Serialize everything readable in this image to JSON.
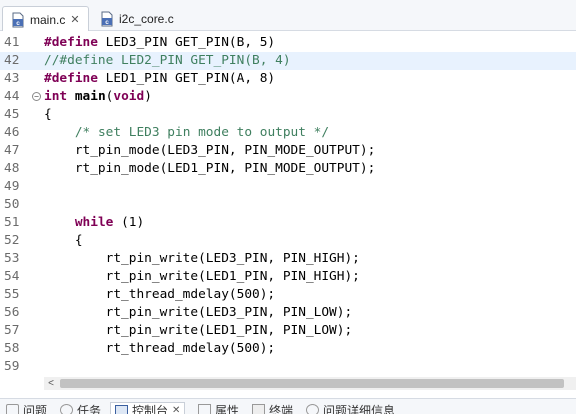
{
  "tabs": [
    {
      "label": "main.c",
      "active": true,
      "close_glyph": "✕",
      "icon": "c-file-icon"
    },
    {
      "label": "i2c_core.c",
      "active": false,
      "icon": "c-file-icon"
    }
  ],
  "editor": {
    "lines": [
      {
        "num": "41",
        "segments": [
          {
            "t": "#define",
            "s": "kw"
          },
          {
            "t": " LED3_PIN GET_PIN(B, 5)",
            "s": ""
          }
        ]
      },
      {
        "num": "42",
        "highlight": true,
        "segments": [
          {
            "t": "//#define LED2_PIN GET_PIN(B, 4)",
            "s": "cm"
          }
        ]
      },
      {
        "num": "43",
        "segments": [
          {
            "t": "#define",
            "s": "kw"
          },
          {
            "t": " LED1_PIN GET_PIN(A, 8)",
            "s": ""
          }
        ]
      },
      {
        "num": "44",
        "fold": true,
        "segments": [
          {
            "t": "int",
            "s": "kw"
          },
          {
            "t": " ",
            "s": ""
          },
          {
            "t": "main",
            "s": "b"
          },
          {
            "t": "(",
            "s": ""
          },
          {
            "t": "void",
            "s": "kw"
          },
          {
            "t": ")",
            "s": ""
          }
        ]
      },
      {
        "num": "45",
        "segments": [
          {
            "t": "{",
            "s": ""
          }
        ]
      },
      {
        "num": "46",
        "segments": [
          {
            "t": "    ",
            "s": ""
          },
          {
            "t": "/* set LED3 pin mode to output */",
            "s": "cm"
          }
        ]
      },
      {
        "num": "47",
        "segments": [
          {
            "t": "    rt_pin_mode(LED3_PIN, PIN_MODE_OUTPUT);",
            "s": ""
          }
        ]
      },
      {
        "num": "48",
        "segments": [
          {
            "t": "    rt_pin_mode(LED1_PIN, PIN_MODE_OUTPUT);",
            "s": ""
          }
        ]
      },
      {
        "num": "49",
        "segments": []
      },
      {
        "num": "50",
        "segments": []
      },
      {
        "num": "51",
        "segments": [
          {
            "t": "    ",
            "s": ""
          },
          {
            "t": "while",
            "s": "kw"
          },
          {
            "t": " (1)",
            "s": ""
          }
        ]
      },
      {
        "num": "52",
        "segments": [
          {
            "t": "    {",
            "s": ""
          }
        ]
      },
      {
        "num": "53",
        "segments": [
          {
            "t": "        rt_pin_write(LED3_PIN, PIN_HIGH);",
            "s": ""
          }
        ]
      },
      {
        "num": "54",
        "segments": [
          {
            "t": "        rt_pin_write(LED1_PIN, PIN_HIGH);",
            "s": ""
          }
        ]
      },
      {
        "num": "55",
        "segments": [
          {
            "t": "        rt_thread_mdelay(500);",
            "s": ""
          }
        ]
      },
      {
        "num": "56",
        "segments": [
          {
            "t": "        rt_pin_write(LED3_PIN, PIN_LOW);",
            "s": ""
          }
        ]
      },
      {
        "num": "57",
        "segments": [
          {
            "t": "        rt_pin_write(LED1_PIN, PIN_LOW);",
            "s": ""
          }
        ]
      },
      {
        "num": "58",
        "segments": [
          {
            "t": "        rt_thread_mdelay(500);",
            "s": ""
          }
        ]
      },
      {
        "num": "59",
        "segments": []
      }
    ]
  },
  "scrollbar": {
    "left_arrow": "<"
  },
  "bottom_tabs": [
    {
      "label": "问题",
      "icon": "problems-icon"
    },
    {
      "label": "任务",
      "icon": "tasks-icon"
    },
    {
      "label": "控制台",
      "icon": "console-icon",
      "active": true,
      "close_glyph": "✕"
    },
    {
      "label": "属性",
      "icon": "properties-icon"
    },
    {
      "label": "终端",
      "icon": "terminal-icon"
    },
    {
      "label": "问题详细信息",
      "icon": "problem-details-icon"
    }
  ],
  "colors": {
    "keyword": "#7f0055",
    "comment": "#3f7f5f",
    "highlight_line": "#e8f2fe"
  }
}
